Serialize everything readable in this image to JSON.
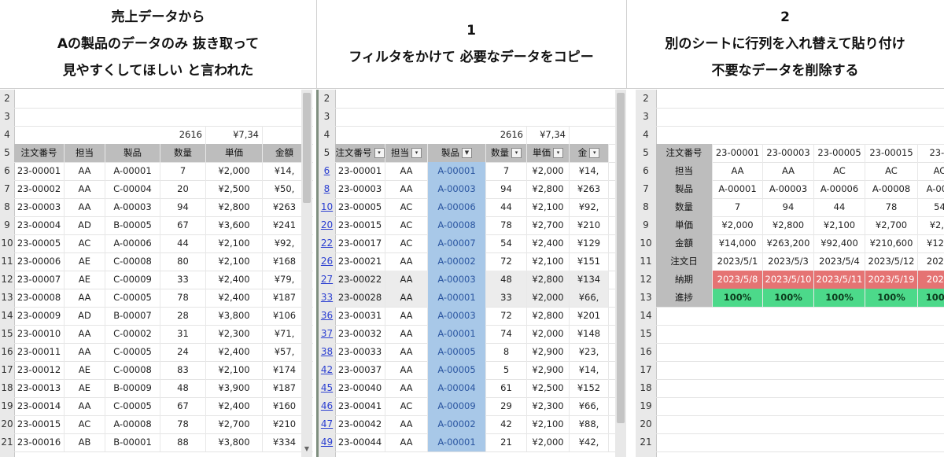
{
  "headers": [
    {
      "lines": [
        "売上データから",
        "Aの製品のデータのみ 抜き取って",
        "見やすくしてほしい と言われた"
      ]
    },
    {
      "lines": [
        "1",
        "フィルタをかけて 必要なデータをコピー"
      ]
    },
    {
      "lines": [
        "2",
        "別のシートに行列を入れ替えて貼り付け",
        "不要なデータを削除する"
      ]
    }
  ],
  "pane1": {
    "row_numbers": [
      "2",
      "3",
      "4",
      "5",
      "6",
      "7",
      "8",
      "9",
      "10",
      "11",
      "12",
      "13",
      "14",
      "15",
      "16",
      "17",
      "18",
      "19",
      "20",
      "21"
    ],
    "totals": [
      "2616",
      "¥7,34"
    ],
    "columns": [
      "注文番号",
      "担当",
      "製品",
      "数量",
      "単価",
      "金額"
    ],
    "rows": [
      [
        "23-00001",
        "AA",
        "A-00001",
        "7",
        "¥2,000",
        "¥14,"
      ],
      [
        "23-00002",
        "AA",
        "C-00004",
        "20",
        "¥2,500",
        "¥50,"
      ],
      [
        "23-00003",
        "AA",
        "A-00003",
        "94",
        "¥2,800",
        "¥263"
      ],
      [
        "23-00004",
        "AD",
        "B-00005",
        "67",
        "¥3,600",
        "¥241"
      ],
      [
        "23-00005",
        "AC",
        "A-00006",
        "44",
        "¥2,100",
        "¥92,"
      ],
      [
        "23-00006",
        "AE",
        "C-00008",
        "80",
        "¥2,100",
        "¥168"
      ],
      [
        "23-00007",
        "AE",
        "C-00009",
        "33",
        "¥2,400",
        "¥79,"
      ],
      [
        "23-00008",
        "AA",
        "C-00005",
        "78",
        "¥2,400",
        "¥187"
      ],
      [
        "23-00009",
        "AD",
        "B-00007",
        "28",
        "¥3,800",
        "¥106"
      ],
      [
        "23-00010",
        "AA",
        "C-00002",
        "31",
        "¥2,300",
        "¥71,"
      ],
      [
        "23-00011",
        "AA",
        "C-00005",
        "24",
        "¥2,400",
        "¥57,"
      ],
      [
        "23-00012",
        "AE",
        "C-00008",
        "83",
        "¥2,100",
        "¥174"
      ],
      [
        "23-00013",
        "AE",
        "B-00009",
        "48",
        "¥3,900",
        "¥187"
      ],
      [
        "23-00014",
        "AA",
        "C-00005",
        "67",
        "¥2,400",
        "¥160"
      ],
      [
        "23-00015",
        "AC",
        "A-00008",
        "78",
        "¥2,700",
        "¥210"
      ],
      [
        "23-00016",
        "AB",
        "B-00001",
        "88",
        "¥3,800",
        "¥334"
      ]
    ]
  },
  "pane2": {
    "row_numbers": [
      "2",
      "3",
      "4",
      "5",
      "6",
      "8",
      "10",
      "20",
      "22",
      "26",
      "27",
      "33",
      "36",
      "37",
      "38",
      "42",
      "45",
      "46",
      "47",
      "49"
    ],
    "totals": [
      "2616",
      "¥7,34"
    ],
    "columns": [
      "注文番号",
      "担当",
      "製品",
      "数量",
      "単価",
      "金"
    ],
    "rows": [
      [
        "23-00001",
        "AA",
        "A-00001",
        "7",
        "¥2,000",
        "¥14,"
      ],
      [
        "23-00003",
        "AA",
        "A-00003",
        "94",
        "¥2,800",
        "¥263"
      ],
      [
        "23-00005",
        "AC",
        "A-00006",
        "44",
        "¥2,100",
        "¥92,"
      ],
      [
        "23-00015",
        "AC",
        "A-00008",
        "78",
        "¥2,700",
        "¥210"
      ],
      [
        "23-00017",
        "AC",
        "A-00007",
        "54",
        "¥2,400",
        "¥129"
      ],
      [
        "23-00021",
        "AA",
        "A-00002",
        "72",
        "¥2,100",
        "¥151"
      ],
      [
        "23-00022",
        "AA",
        "A-00003",
        "48",
        "¥2,800",
        "¥134"
      ],
      [
        "23-00028",
        "AA",
        "A-00001",
        "33",
        "¥2,000",
        "¥66,"
      ],
      [
        "23-00031",
        "AA",
        "A-00003",
        "72",
        "¥2,800",
        "¥201"
      ],
      [
        "23-00032",
        "AA",
        "A-00001",
        "74",
        "¥2,000",
        "¥148"
      ],
      [
        "23-00033",
        "AA",
        "A-00005",
        "8",
        "¥2,900",
        "¥23,"
      ],
      [
        "23-00037",
        "AA",
        "A-00005",
        "5",
        "¥2,900",
        "¥14,"
      ],
      [
        "23-00040",
        "AA",
        "A-00004",
        "61",
        "¥2,500",
        "¥152"
      ],
      [
        "23-00041",
        "AC",
        "A-00009",
        "29",
        "¥2,300",
        "¥66,"
      ],
      [
        "23-00042",
        "AA",
        "A-00002",
        "42",
        "¥2,100",
        "¥88,"
      ],
      [
        "23-00044",
        "AA",
        "A-00001",
        "21",
        "¥2,000",
        "¥42,"
      ]
    ]
  },
  "pane3": {
    "row_numbers": [
      "2",
      "3",
      "4",
      "5",
      "6",
      "7",
      "8",
      "9",
      "10",
      "11",
      "12",
      "13",
      "14",
      "15",
      "16",
      "17",
      "18",
      "19",
      "20",
      "21"
    ],
    "labels": [
      "注文番号",
      "担当",
      "製品",
      "数量",
      "単価",
      "金額",
      "注文日",
      "納期",
      "進捗"
    ],
    "cols": [
      [
        "23-00001",
        "AA",
        "A-00001",
        "7",
        "¥2,000",
        "¥14,000",
        "2023/5/1",
        "2023/5/8",
        "100%"
      ],
      [
        "23-00003",
        "AA",
        "A-00003",
        "94",
        "¥2,800",
        "¥263,200",
        "2023/5/3",
        "2023/5/10",
        "100%"
      ],
      [
        "23-00005",
        "AC",
        "A-00006",
        "44",
        "¥2,100",
        "¥92,400",
        "2023/5/4",
        "2023/5/11",
        "100%"
      ],
      [
        "23-00015",
        "AC",
        "A-00008",
        "78",
        "¥2,700",
        "¥210,600",
        "2023/5/12",
        "2023/5/19",
        "100%"
      ],
      [
        "23-0",
        "AC",
        "A-000",
        "54",
        "¥2,4",
        "¥129,",
        "2023/",
        "2023/",
        "100%"
      ]
    ]
  }
}
